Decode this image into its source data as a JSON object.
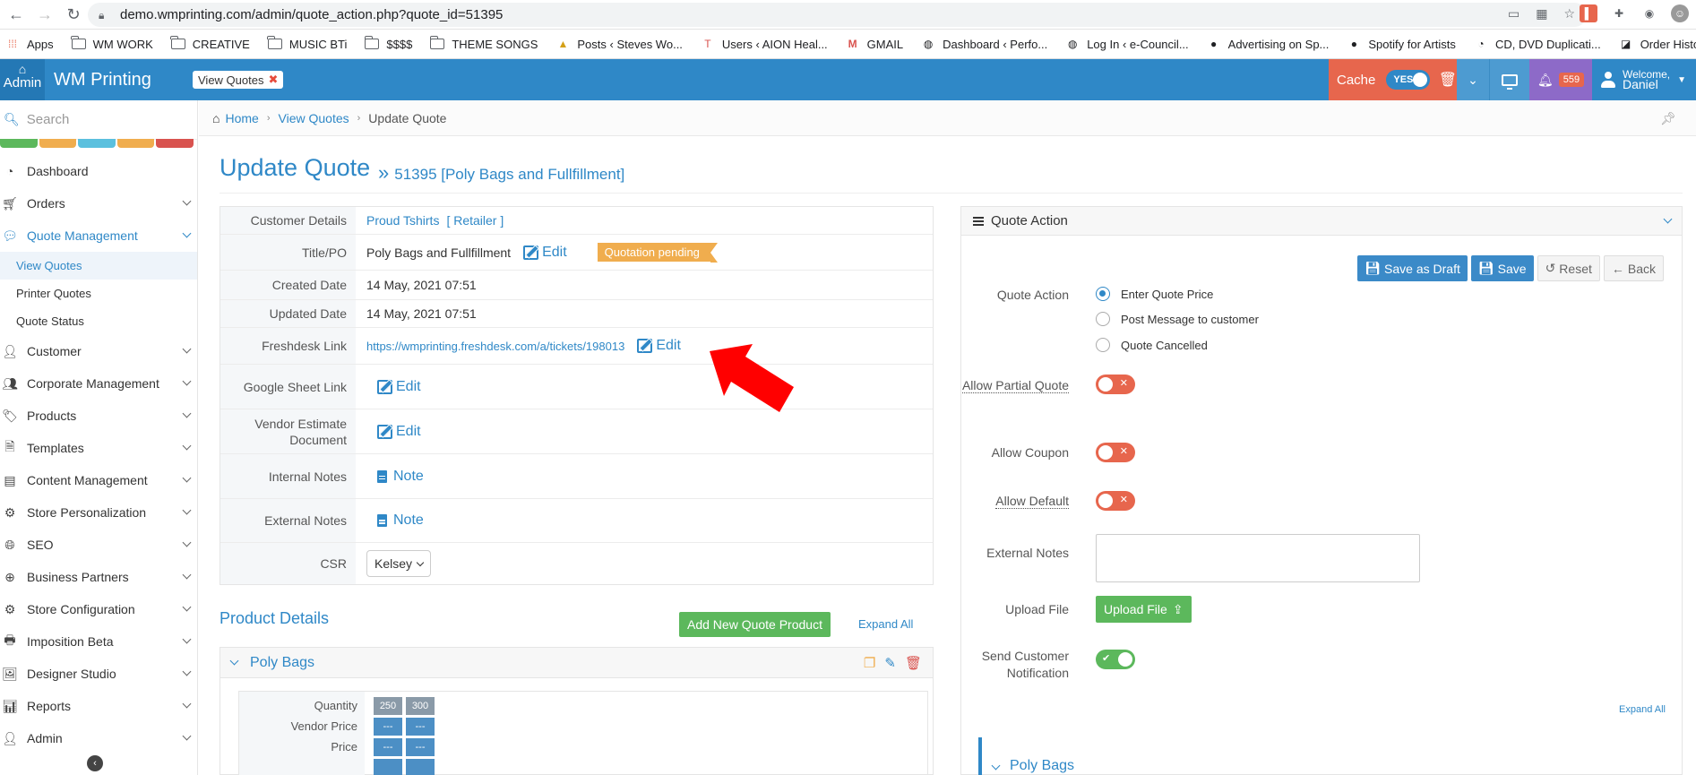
{
  "browser": {
    "url": "demo.wmprinting.com/admin/quote_action.php?quote_id=51395",
    "bookmarks": [
      "Apps",
      "WM WORK",
      "CREATIVE",
      "MUSIC BTi",
      "$$$$",
      "THEME SONGS",
      "Posts ‹ Steves Wo...",
      "Users ‹ AION Heal...",
      "GMAIL",
      "Dashboard ‹ Perfo...",
      "Log In ‹ e-Council...",
      "Advertising on Sp...",
      "Spotify for Artists",
      "CD, DVD Duplicati...",
      "Order History"
    ]
  },
  "header": {
    "home_label": "Admin",
    "brand": "WM Printing",
    "open_tab": "View Quotes",
    "cache_label": "Cache",
    "cache_toggle": "YES",
    "notifications": "559",
    "welcome": "Welcome,",
    "user": "Daniel"
  },
  "sidebar": {
    "search_placeholder": "Search",
    "color_bars": [
      "#5cb85c",
      "#f0ad4e",
      "#5bc0de",
      "#f0ad4e",
      "#d9534f"
    ],
    "items": [
      {
        "label": "Dashboard"
      },
      {
        "label": "Orders"
      },
      {
        "label": "Quote Management"
      },
      {
        "label": "Customer"
      },
      {
        "label": "Corporate Management"
      },
      {
        "label": "Products"
      },
      {
        "label": "Templates"
      },
      {
        "label": "Content Management"
      },
      {
        "label": "Store Personalization"
      },
      {
        "label": "SEO"
      },
      {
        "label": "Business Partners"
      },
      {
        "label": "Store Configuration"
      },
      {
        "label": "Imposition Beta"
      },
      {
        "label": "Designer Studio"
      },
      {
        "label": "Reports"
      },
      {
        "label": "Admin"
      }
    ],
    "subitems": [
      "View Quotes",
      "Printer Quotes",
      "Quote Status"
    ]
  },
  "breadcrumb": [
    "Home",
    "View Quotes",
    "Update Quote"
  ],
  "page": {
    "title": "Update Quote",
    "subtitle": "51395 [Poly Bags and Fullfillment]"
  },
  "details": {
    "customer_label": "Customer Details",
    "customer_name": "Proud Tshirts",
    "customer_type": "[ Retailer ]",
    "title_label": "Title/PO",
    "title_value": "Poly Bags and Fullfillment",
    "status": "Quotation pending",
    "created_label": "Created Date",
    "created_value": "14 May, 2021 07:51",
    "updated_label": "Updated Date",
    "updated_value": "14 May, 2021 07:51",
    "freshdesk_label": "Freshdesk Link",
    "freshdesk_value": "https://wmprinting.freshdesk.com/a/tickets/198013",
    "google_label": "Google Sheet Link",
    "vendor_label": "Vendor Estimate Document",
    "internal_label": "Internal Notes",
    "external_label": "External Notes",
    "csr_label": "CSR",
    "csr_value": "Kelsey",
    "edit": "Edit",
    "note": "Note"
  },
  "product_details": {
    "title": "Product Details",
    "add_button": "Add New Quote Product",
    "expand_all": "Expand All",
    "product_name": "Poly Bags",
    "row_labels": [
      "Quantity",
      "Vendor Price",
      "Price"
    ],
    "quantities": [
      "250",
      "300"
    ],
    "placeholder": "---"
  },
  "quote_action": {
    "panel_title": "Quote Action",
    "buttons": {
      "save_draft": "Save as Draft",
      "save": "Save",
      "reset": "Reset",
      "back": "Back"
    },
    "action_label": "Quote Action",
    "options": [
      "Enter Quote Price",
      "Post Message to customer",
      "Quote Cancelled"
    ],
    "partial_label": "Allow Partial Quote",
    "coupon_label": "Allow Coupon",
    "default_label": "Allow Default",
    "ext_notes_label": "External Notes",
    "upload_label": "Upload File",
    "upload_button": "Upload File",
    "send_label": "Send Customer Notification",
    "expand_all": "Expand All",
    "product_name": "Poly Bags"
  }
}
